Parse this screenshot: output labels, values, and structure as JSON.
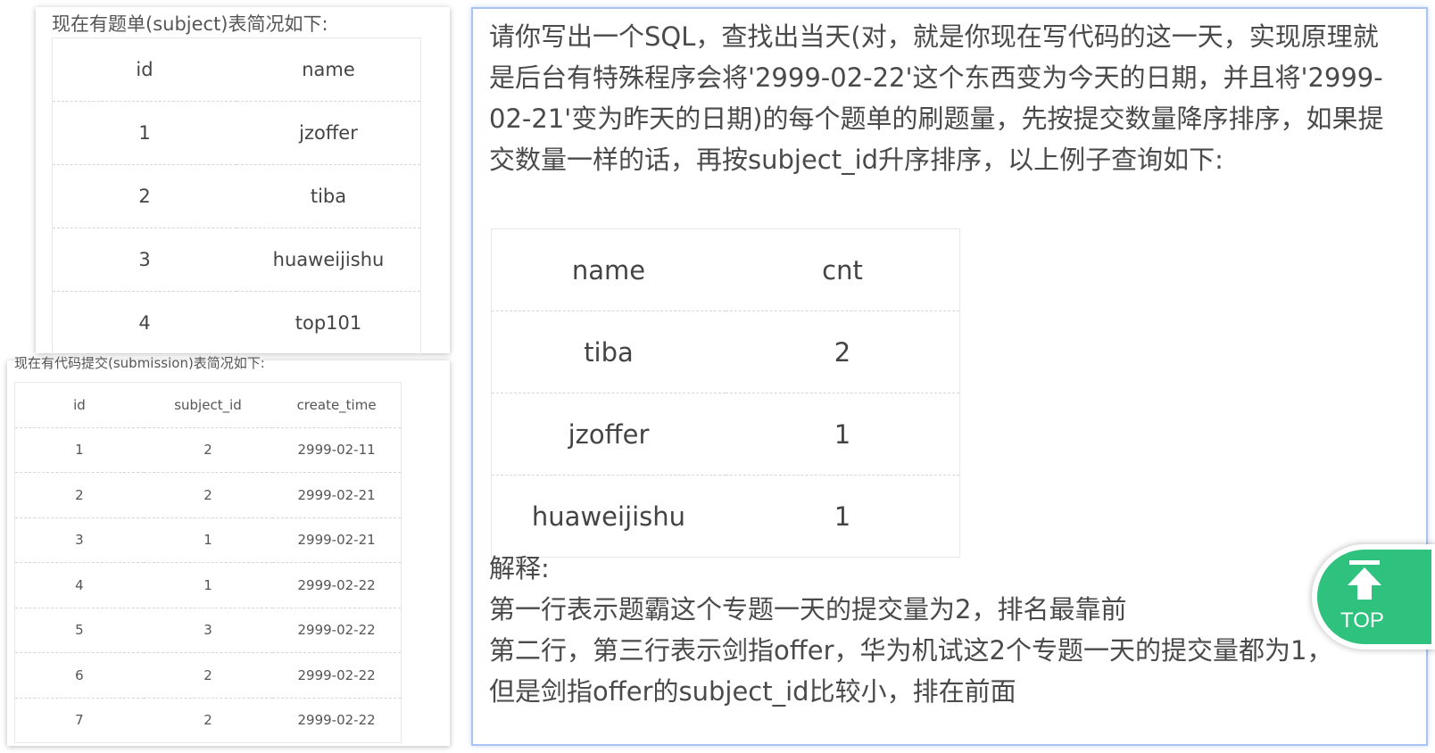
{
  "subject": {
    "caption": "现在有题单(subject)表简况如下:",
    "headers": [
      "id",
      "name"
    ],
    "rows": [
      [
        "1",
        "jzoffer"
      ],
      [
        "2",
        "tiba"
      ],
      [
        "3",
        "huaweijishu"
      ],
      [
        "4",
        "top101"
      ]
    ]
  },
  "submission": {
    "caption": "现在有代码提交(submission)表简况如下:",
    "headers": [
      "id",
      "subject_id",
      "create_time"
    ],
    "rows": [
      [
        "1",
        "2",
        "2999-02-11"
      ],
      [
        "2",
        "2",
        "2999-02-21"
      ],
      [
        "3",
        "1",
        "2999-02-21"
      ],
      [
        "4",
        "1",
        "2999-02-22"
      ],
      [
        "5",
        "3",
        "2999-02-22"
      ],
      [
        "6",
        "2",
        "2999-02-22"
      ],
      [
        "7",
        "2",
        "2999-02-22"
      ]
    ]
  },
  "question": {
    "text": "请你写出一个SQL，查找出当天(对，就是你现在写代码的这一天，实现原理就是后台有特殊程序会将'2999-02-22'这个东西变为今天的日期，并且将'2999-02-21'变为昨天的日期)的每个题单的刷题量，先按提交数量降序排序，如果提交数量一样的话，再按subject_id升序排序，以上例子查询如下:",
    "result_headers": [
      "name",
      "cnt"
    ],
    "result_rows": [
      [
        "tiba",
        "2"
      ],
      [
        "jzoffer",
        "1"
      ],
      [
        "huaweijishu",
        "1"
      ]
    ],
    "explain_title": "解释:",
    "explain_lines": [
      "第一行表示题霸这个专题一天的提交量为2，排名最靠前",
      "第二行，第三行表示剑指offer，华为机试这2个专题一天的提交量都为1，",
      "但是剑指offer的subject_id比较小，排在前面"
    ]
  },
  "top_button": {
    "label": "TOP",
    "icon": "arrow-up-icon",
    "color": "#2ec27e"
  }
}
